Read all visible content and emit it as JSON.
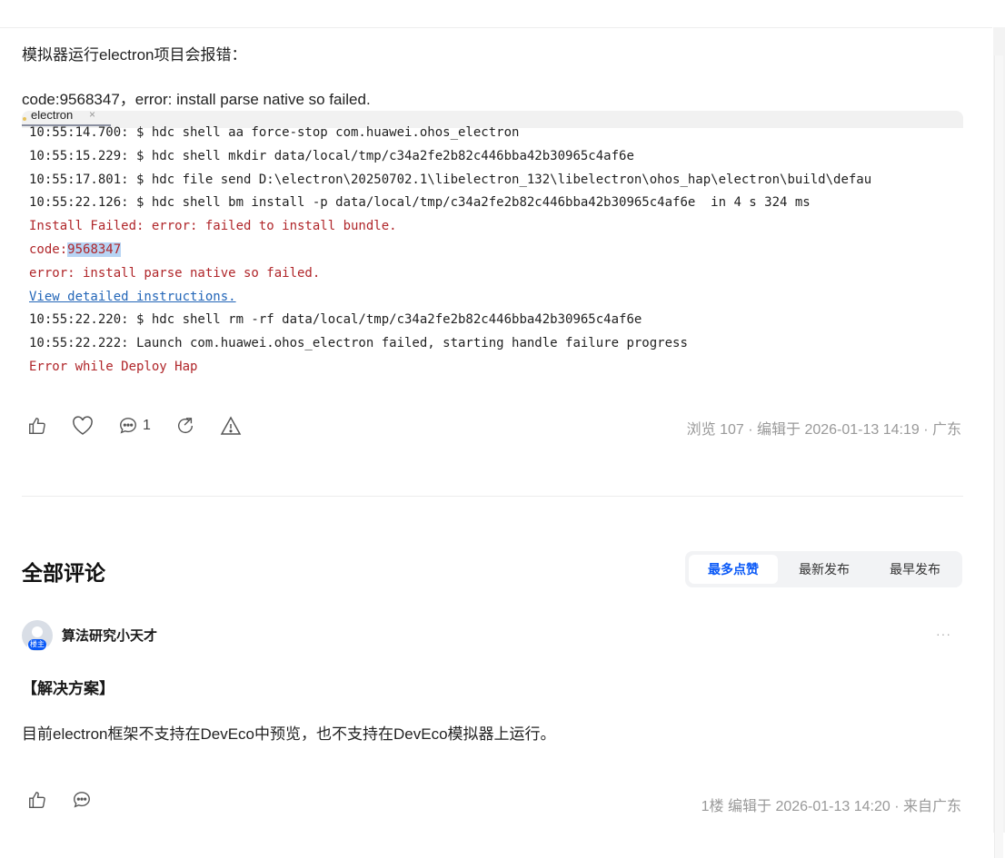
{
  "post": {
    "paragraph1": "模拟器运行electron项目会报错：",
    "paragraph2": "code:9568347，error: install parse native so failed."
  },
  "screenshot": {
    "tab_label": "electron",
    "tab_close": "×",
    "lines": [
      {
        "text": "10:55:14.700: $ hdc shell aa force-stop com.huawei.ohos_electron",
        "style": "dark"
      },
      {
        "text": "10:55:15.229: $ hdc shell mkdir data/local/tmp/c34a2fe2b82c446bba42b30965c4af6e",
        "style": "dark"
      },
      {
        "text": "10:55:17.801: $ hdc file send D:\\electron\\20250702.1\\libelectron_132\\libelectron\\ohos_hap\\electron\\build\\defau",
        "style": "dark"
      },
      {
        "text": "10:55:22.126: $ hdc shell bm install -p data/local/tmp/c34a2fe2b82c446bba42b30965c4af6e  in 4 s 324 ms",
        "style": "dark"
      },
      {
        "text": "Install Failed: error: failed to install bundle.",
        "style": "red"
      },
      {
        "text": "code:",
        "highlight": "9568347",
        "style": "red"
      },
      {
        "text": "error: install parse native so failed.",
        "style": "red"
      },
      {
        "text": "View detailed instructions.",
        "style": "link"
      },
      {
        "text": "10:55:22.220: $ hdc shell rm -rf data/local/tmp/c34a2fe2b82c446bba42b30965c4af6e",
        "style": "dark"
      },
      {
        "text": "10:55:22.222: Launch com.huawei.ohos_electron failed, starting handle failure progress",
        "style": "dark"
      },
      {
        "text": "Error while Deploy Hap",
        "style": "red"
      }
    ]
  },
  "post_actions": {
    "icons": [
      "thumbs-up-icon",
      "heart-icon",
      "comment-icon",
      "share-icon",
      "report-icon"
    ],
    "comment_count": "1"
  },
  "post_meta": "浏览 107 · 编辑于 2026-01-13 14:19 · 广东",
  "comments": {
    "title": "全部评论",
    "sort_tabs": [
      "最多点赞",
      "最新发布",
      "最早发布"
    ],
    "active_sort": "最多点赞",
    "items": [
      {
        "username": "算法研究小天才",
        "badge": "楼主",
        "more": "···",
        "heading": "【解决方案】",
        "body": "目前electron框架不支持在DevEco中预览，也不支持在DevEco模拟器上运行。",
        "meta": "1楼  编辑于 2026-01-13 14:20 · 来自广东"
      }
    ]
  },
  "colors": {
    "accent": "#0a59f7",
    "console_red": "#b0262a",
    "console_link": "#2366b8",
    "selection": "#b7d4f4"
  }
}
